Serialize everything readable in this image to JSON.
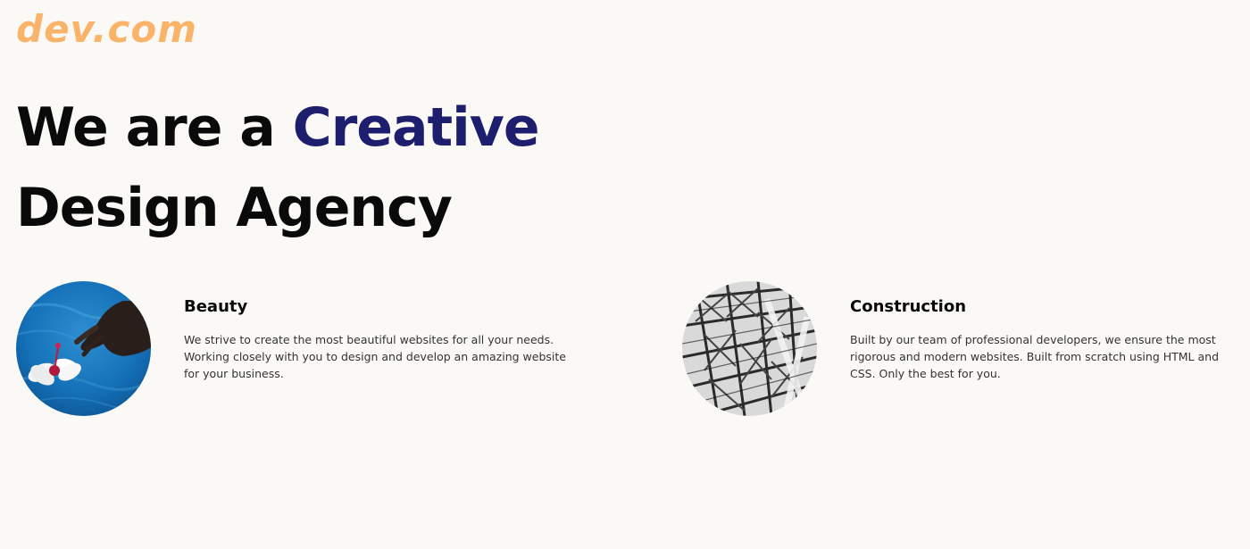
{
  "header": {
    "logo_text": "dev.com"
  },
  "hero": {
    "line1_prefix": "We are a ",
    "line1_accent": "Creative",
    "line2": "Design Agency"
  },
  "features": [
    {
      "title": "Beauty",
      "description": "We strive to create the most beautiful websites for all your needs. Working closely with you to design and develop an amazing website for your business.",
      "image": "hand-touching-water-with-flower"
    },
    {
      "title": "Construction",
      "description": "Built by our team of professional developers, we ensure the most rigorous and modern websites. Built from scratch using HTML and CSS. Only the best for you.",
      "image": "steel-structure-black-and-white"
    }
  ],
  "colors": {
    "background": "#fbf9f6",
    "logo": "#f9b46a",
    "accent": "#1e1e6e",
    "heading": "#0a0a0a"
  }
}
